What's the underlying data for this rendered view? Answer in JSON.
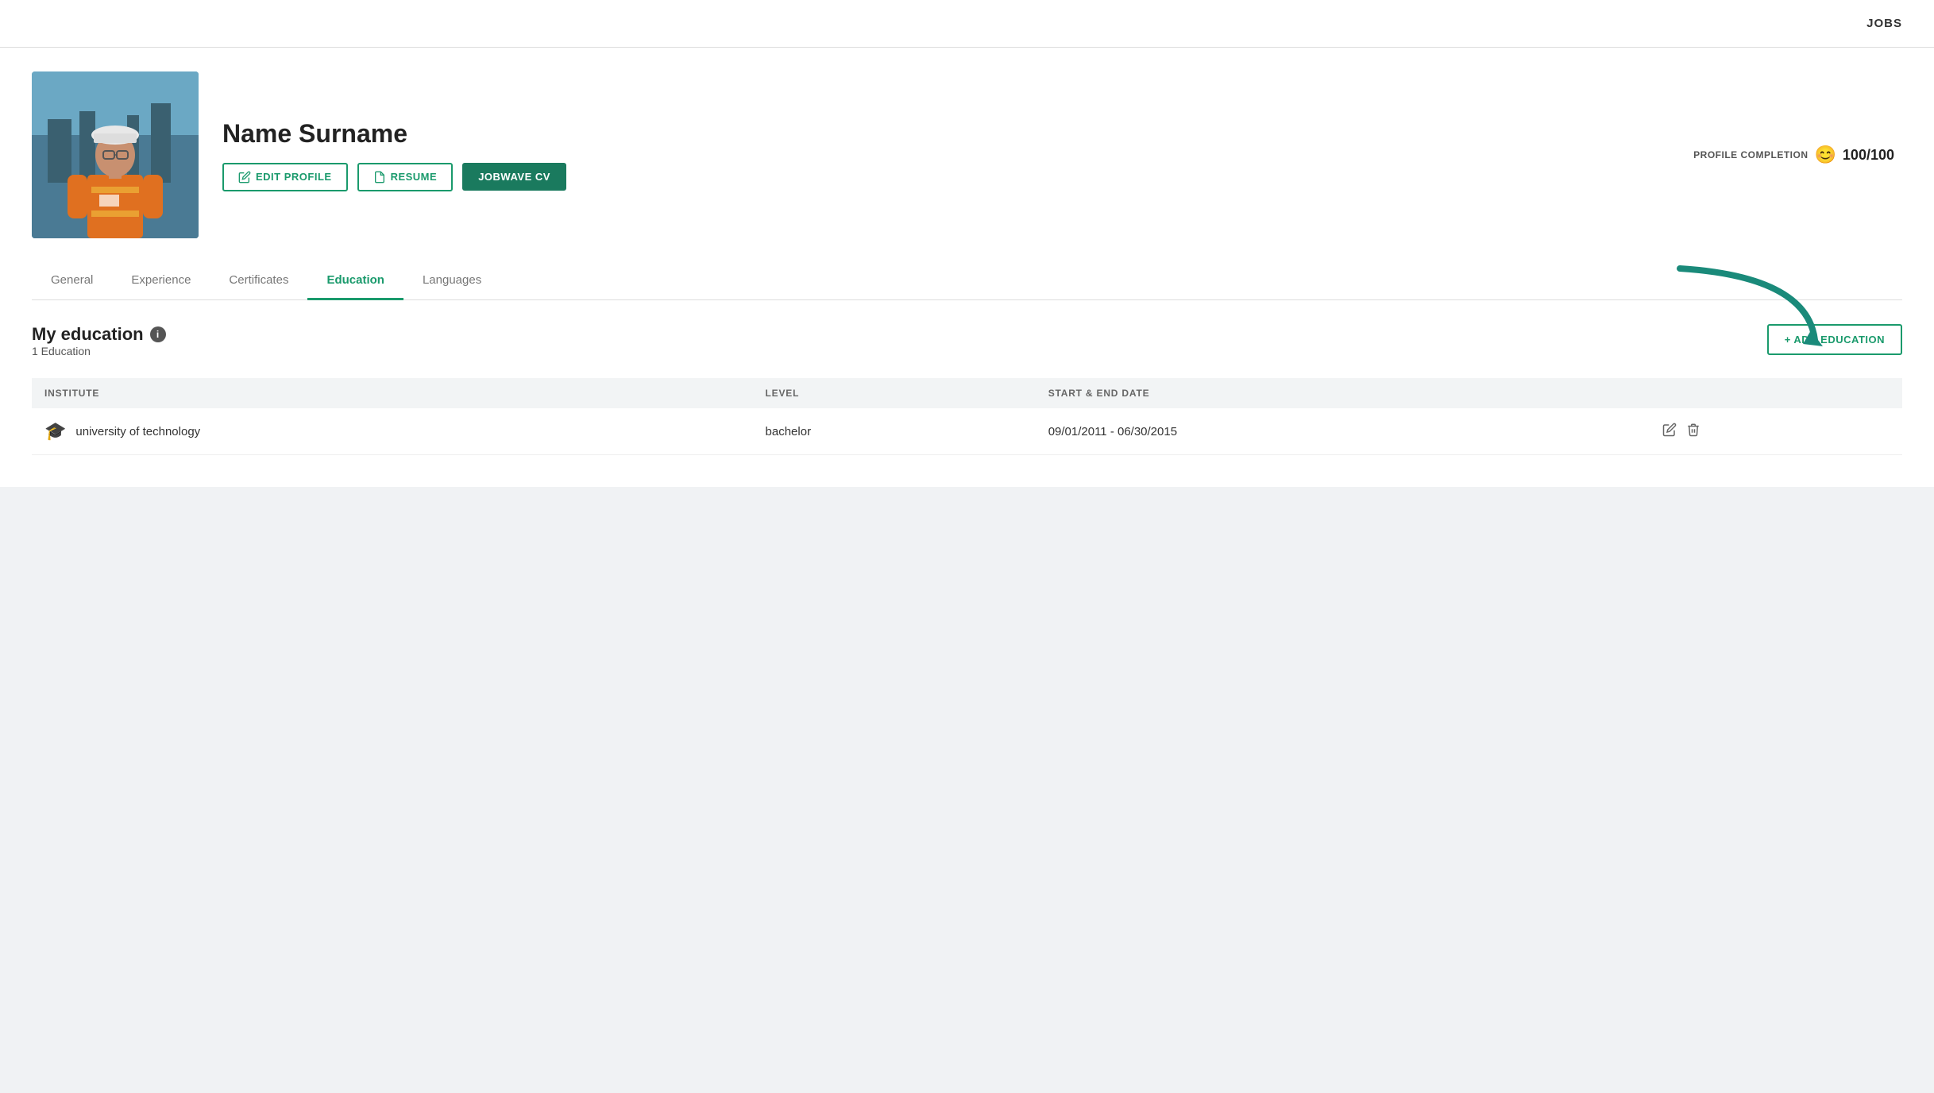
{
  "nav": {
    "jobs_label": "JOBS"
  },
  "profile": {
    "name": "Name Surname",
    "buttons": {
      "edit_profile": "EDIT PROFILE",
      "resume": "RESUME",
      "jobwave_cv": "JOBWAVE CV"
    },
    "completion": {
      "label": "PROFILE COMPLETION",
      "score": "100/100"
    }
  },
  "tabs": [
    {
      "id": "general",
      "label": "General",
      "active": false
    },
    {
      "id": "experience",
      "label": "Experience",
      "active": false
    },
    {
      "id": "certificates",
      "label": "Certificates",
      "active": false
    },
    {
      "id": "education",
      "label": "Education",
      "active": true
    },
    {
      "id": "languages",
      "label": "Languages",
      "active": false
    }
  ],
  "education": {
    "section_title": "My education",
    "count_label": "1 Education",
    "add_button": "+ ADD EDUCATION",
    "table": {
      "columns": [
        {
          "id": "institute",
          "label": "INSTITUTE"
        },
        {
          "id": "level",
          "label": "LEVEL"
        },
        {
          "id": "date_range",
          "label": "START & END DATE"
        }
      ],
      "rows": [
        {
          "institute": "university of technology",
          "level": "bachelor",
          "date_range": "09/01/2011 - 06/30/2015"
        }
      ]
    }
  }
}
